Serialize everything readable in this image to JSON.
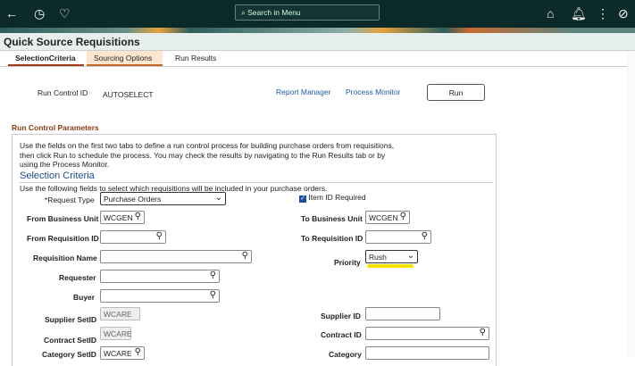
{
  "topbar": {
    "search_placeholder": "Search in Menu"
  },
  "page": {
    "title": "Quick Source Requisitions"
  },
  "tabs": [
    "SelectionCriteria",
    "Sourcing Options",
    "Run Results"
  ],
  "run": {
    "label": "Run Control ID",
    "value": "AUTOSELECT",
    "report_manager": "Report Manager",
    "process_monitor": "Process Monitor",
    "run_button": "Run"
  },
  "section": {
    "title": "Run Control Parameters",
    "intro": "Use the fields on the first two tabs to define a run control process for building purchase orders from requisitions, then click Run to schedule the process. You may check the results by navigating to the Run Results tab or by using the Process Monitor.",
    "sub_title": "Selection Criteria",
    "sub_intro": "Use the following fields to select which requisitions will be included in your purchase orders."
  },
  "fields": {
    "request_type": {
      "label": "*Request Type",
      "value": "Purchase Orders"
    },
    "item_id_required": {
      "label": "Item ID Required",
      "checked": true
    },
    "from_bu": {
      "label": "From Business Unit",
      "value": "WCGEN"
    },
    "to_bu": {
      "label": "To Business Unit",
      "value": "WCGEN"
    },
    "from_req": {
      "label": "From Requisition ID",
      "value": ""
    },
    "to_req": {
      "label": "To Requisition ID",
      "value": ""
    },
    "req_name": {
      "label": "Requisition Name",
      "value": ""
    },
    "priority": {
      "label": "Priority",
      "value": "Rush"
    },
    "requester": {
      "label": "Requester",
      "value": ""
    },
    "buyer": {
      "label": "Buyer",
      "value": ""
    },
    "supplier_setid": {
      "label": "Supplier SetID",
      "value": "WCARE"
    },
    "supplier_id": {
      "label": "Supplier ID",
      "value": ""
    },
    "contract_setid": {
      "label": "Contract SetID",
      "value": "WCARE"
    },
    "contract_id": {
      "label": "Contract ID",
      "value": ""
    },
    "category_setid": {
      "label": "Category SetID",
      "value": "WCARE"
    },
    "category": {
      "label": "Category",
      "value": ""
    }
  },
  "colors": {
    "highlight": "#f2e600",
    "accent": "#8a3b12"
  }
}
